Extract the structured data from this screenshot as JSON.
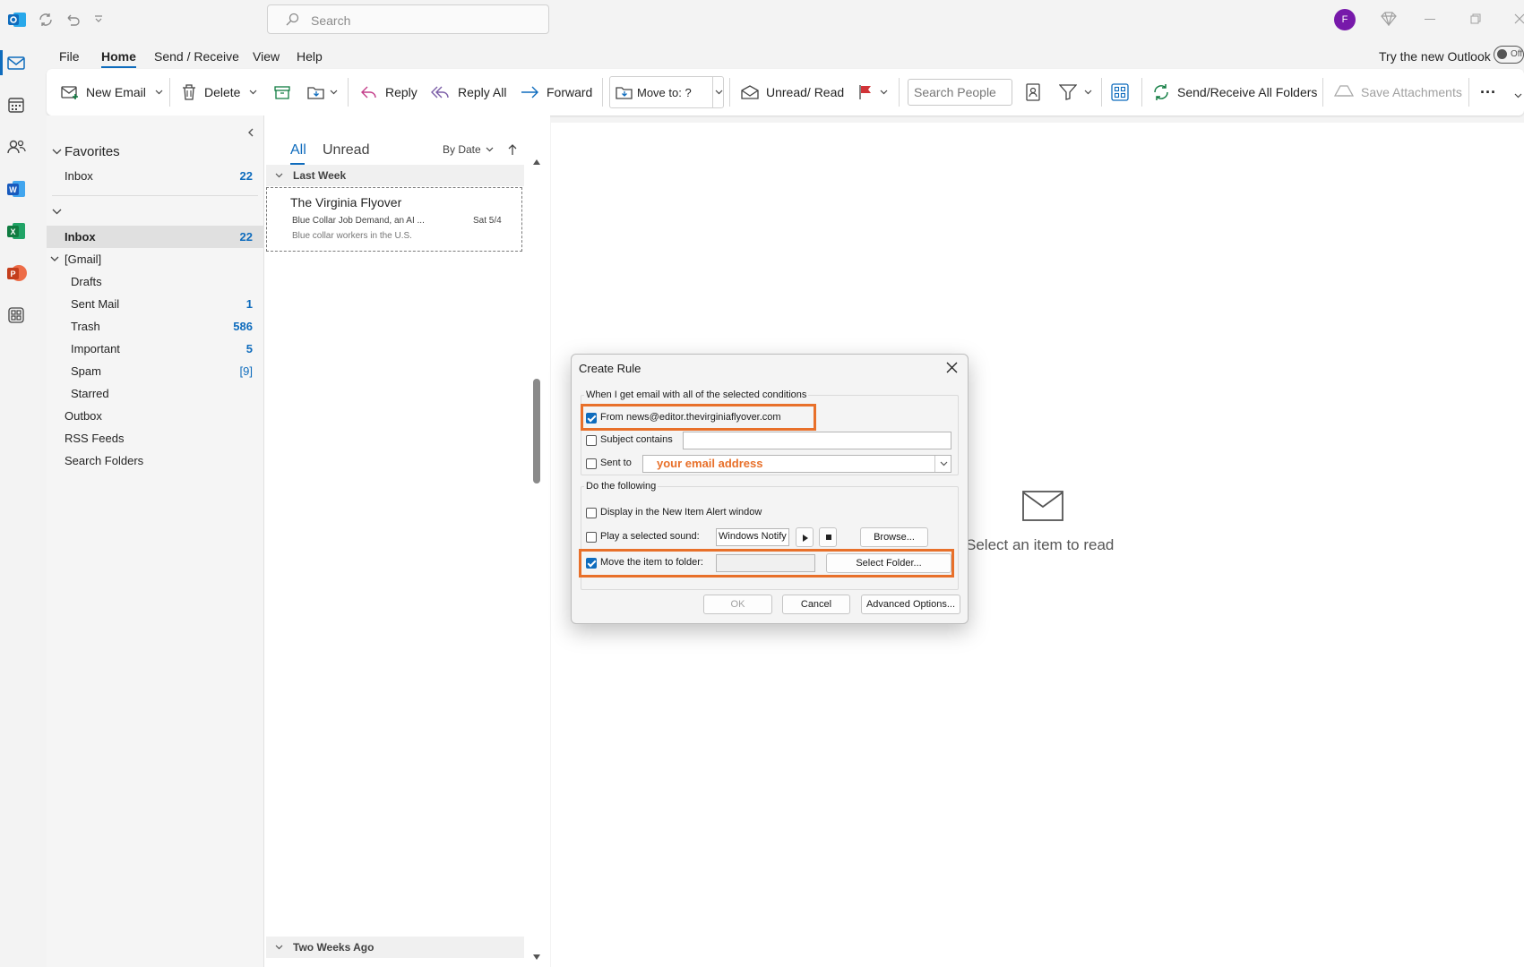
{
  "titlebar": {
    "search_placeholder": "Search",
    "avatar_initial": "F"
  },
  "menu": {
    "tabs": [
      "File",
      "Home",
      "Send / Receive",
      "View",
      "Help"
    ],
    "try_new": "Try the new Outlook",
    "toggle_label": "Off"
  },
  "ribbon": {
    "new_email": "New Email",
    "delete": "Delete",
    "reply": "Reply",
    "reply_all": "Reply All",
    "forward": "Forward",
    "move_to": "Move to: ?",
    "unread_read": "Unread/ Read",
    "search_people_placeholder": "Search People",
    "send_receive": "Send/Receive All Folders",
    "save_attachments": "Save Attachments",
    "more": "···"
  },
  "folders": {
    "favorites_header": "Favorites",
    "favorites": [
      {
        "label": "Inbox",
        "count": "22"
      }
    ],
    "inbox": {
      "label": "Inbox",
      "count": "22"
    },
    "gmail_header": "[Gmail]",
    "gmail": [
      {
        "label": "Drafts",
        "count": ""
      },
      {
        "label": "Sent Mail",
        "count": "1"
      },
      {
        "label": "Trash",
        "count": "586"
      },
      {
        "label": "Important",
        "count": "5"
      },
      {
        "label": "Spam",
        "count": "[9]"
      },
      {
        "label": "Starred",
        "count": ""
      }
    ],
    "others": [
      "Outbox",
      "RSS Feeds",
      "Search Folders"
    ]
  },
  "message_list": {
    "tab_all": "All",
    "tab_unread": "Unread",
    "sort": "By Date",
    "group_last_week": "Last Week",
    "group_two_weeks": "Two Weeks Ago",
    "messages": [
      {
        "sender": "The Virginia Flyover",
        "subject": "Blue Collar Job Demand, an AI ...",
        "date": "Sat 5/4",
        "preview": "Blue collar workers in the U.S."
      }
    ]
  },
  "reading_pane": {
    "empty_text": "Select an item to read"
  },
  "dialog": {
    "title": "Create Rule",
    "conditions_label": "When I get email with all of the selected conditions",
    "from_label": "From",
    "from_value": "news@editor.thevirginiaflyover.com",
    "from_checked": true,
    "subject_label": "Subject contains",
    "subject_value": "",
    "sent_to_label": "Sent to",
    "sent_to_annotation": "your email address",
    "actions_label": "Do the following",
    "display_alert_label": "Display in the New Item Alert window",
    "play_sound_label": "Play a selected sound:",
    "sound_value": "Windows Notify Email.",
    "browse": "Browse...",
    "move_label": "Move the item to folder:",
    "move_checked": true,
    "select_folder": "Select Folder...",
    "ok": "OK",
    "cancel": "Cancel",
    "advanced": "Advanced Options...",
    "highlight_color": "#e8702a"
  }
}
